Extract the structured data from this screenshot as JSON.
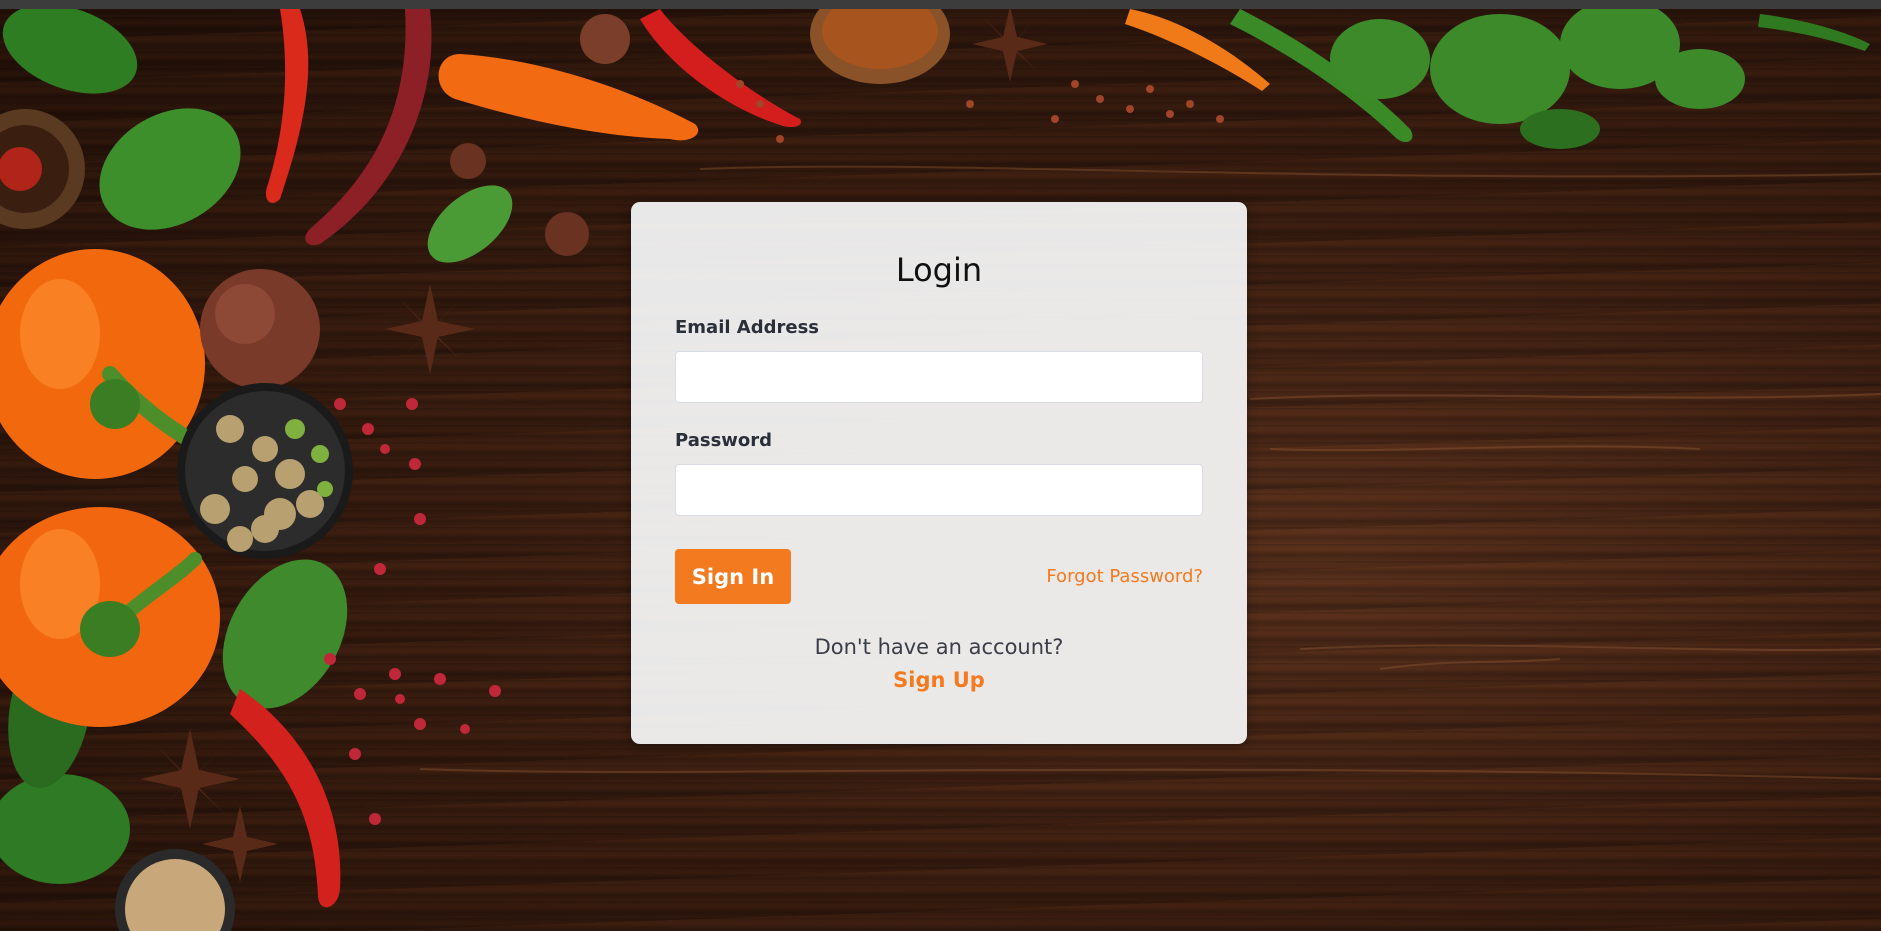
{
  "login": {
    "title": "Login",
    "email_label": "Email Address",
    "email_value": "",
    "email_placeholder": "",
    "password_label": "Password",
    "password_value": "",
    "password_placeholder": "",
    "signin_label": "Sign In",
    "forgot_label": "Forgot Password?",
    "no_account_text": "Don't have an account?",
    "signup_label": "Sign Up"
  },
  "background": {
    "description_icons": [
      "red-chili-pepper-icon",
      "orange-bell-pepper-icon",
      "basil-leaf-icon",
      "star-anise-icon",
      "peppercorn-icon",
      "spice-bowl-icon",
      "green-chili-pepper-icon",
      "onion-icon"
    ]
  },
  "colors": {
    "accent": "#f37a1e",
    "card_background": "#f0f0f0",
    "wood_dark": "#2a140a",
    "wood_mid": "#5a311d"
  }
}
